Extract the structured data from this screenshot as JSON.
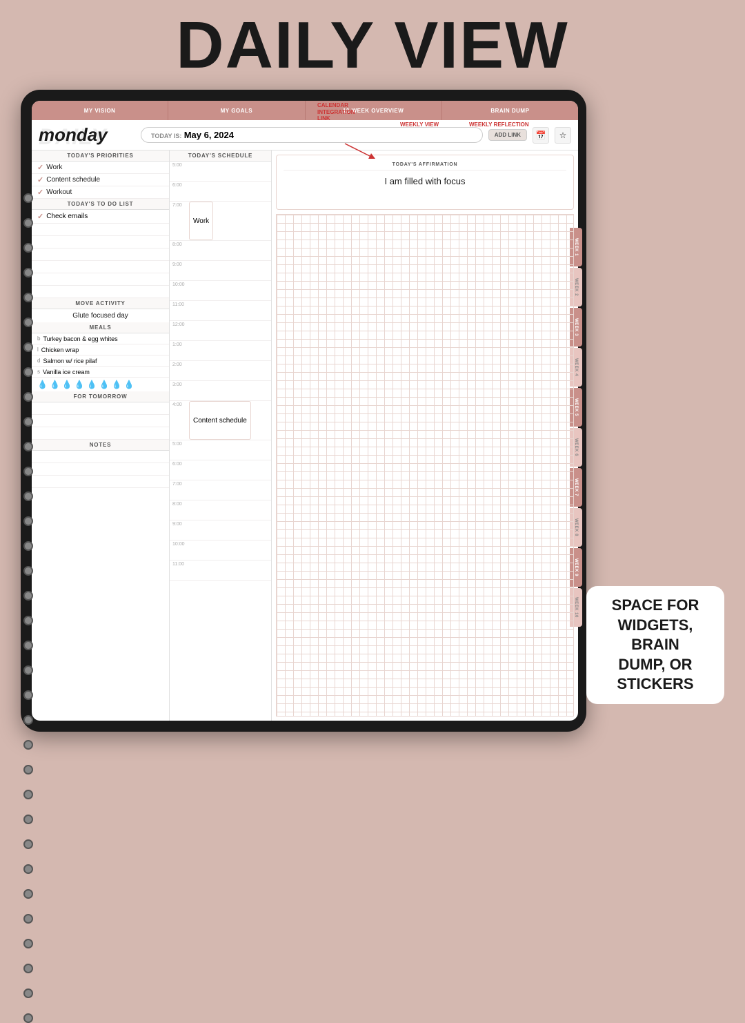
{
  "page": {
    "title": "DAILY VIEW",
    "background_color": "#d4b8b0"
  },
  "annotations": {
    "calendar_integration": "CALENDAR\nINTEGRATION\nLINK",
    "weekly_view": "WEEKLY VIEW",
    "weekly_reflection": "WEEKLY REFLECTION",
    "add_link": "ADD LINK",
    "widget_space": "SPACE FOR\nWIDGETS, BRAIN\nDUMP, OR STICKERS"
  },
  "nav_tabs": [
    {
      "label": "MY VISION"
    },
    {
      "label": "MY GOALS"
    },
    {
      "label": "12 WEEK OVERVIEW"
    },
    {
      "label": "BRAIN DUMP"
    }
  ],
  "side_tabs": [
    {
      "label": "WEEK 1"
    },
    {
      "label": "WEEK 2"
    },
    {
      "label": "WEEK 3"
    },
    {
      "label": "WEEK 4"
    },
    {
      "label": "WEEK 5"
    },
    {
      "label": "WEEK 6"
    },
    {
      "label": "WEEK 7"
    },
    {
      "label": "WEEK 8"
    },
    {
      "label": "WEEK 9"
    },
    {
      "label": "WEEK 10"
    }
  ],
  "header": {
    "day": "monday",
    "today_label": "TODAY IS:",
    "today_date": "May 6, 2024",
    "add_link_label": "ADD LINK"
  },
  "priorities": {
    "section_title": "TODAY'S PRIORITIES",
    "items": [
      {
        "checked": true,
        "text": "Work"
      },
      {
        "checked": true,
        "text": "Content schedule"
      },
      {
        "checked": true,
        "text": "Workout"
      }
    ]
  },
  "todo": {
    "section_title": "TODAY'S TO DO LIST",
    "items": [
      {
        "checked": true,
        "text": "Check emails"
      },
      {
        "checked": false,
        "text": ""
      },
      {
        "checked": false,
        "text": ""
      },
      {
        "checked": false,
        "text": ""
      },
      {
        "checked": false,
        "text": ""
      },
      {
        "checked": false,
        "text": ""
      },
      {
        "checked": false,
        "text": ""
      }
    ]
  },
  "move_activity": {
    "section_title": "MOVE ACTIVITY",
    "text": "Glute focused day"
  },
  "meals": {
    "section_title": "MEALS",
    "items": [
      {
        "type": "b",
        "text": "Turkey bacon & egg whites"
      },
      {
        "type": "l",
        "text": "Chicken wrap"
      },
      {
        "type": "d",
        "text": "Salmon w/ rice pilaf"
      },
      {
        "type": "s",
        "text": "Vanilla ice cream"
      }
    ],
    "water_drops": 8
  },
  "for_tomorrow": {
    "section_title": "FOR TOMORROW",
    "items": [
      "",
      "",
      ""
    ]
  },
  "notes": {
    "section_title": "NOTES",
    "items": [
      "",
      "",
      ""
    ]
  },
  "schedule": {
    "section_title": "TODAY'S SCHEDULE",
    "time_slots": [
      {
        "time": "5:00",
        "event": ""
      },
      {
        "time": "6:00",
        "event": ""
      },
      {
        "time": "7:00",
        "event": "Work",
        "duration": 2
      },
      {
        "time": "8:00",
        "event": ""
      },
      {
        "time": "9:00",
        "event": ""
      },
      {
        "time": "10:00",
        "event": ""
      },
      {
        "time": "11:00",
        "event": ""
      },
      {
        "time": "12:00",
        "event": ""
      },
      {
        "time": "1:00",
        "event": ""
      },
      {
        "time": "2:00",
        "event": ""
      },
      {
        "time": "3:00",
        "event": ""
      },
      {
        "time": "4:00",
        "event": "Content schedule",
        "duration": 2
      },
      {
        "time": "5:00",
        "event": ""
      },
      {
        "time": "6:00",
        "event": ""
      },
      {
        "time": "7:00",
        "event": ""
      },
      {
        "time": "8:00",
        "event": ""
      },
      {
        "time": "9:00",
        "event": ""
      },
      {
        "time": "10:00",
        "event": ""
      },
      {
        "time": "11:00",
        "event": ""
      }
    ]
  },
  "affirmation": {
    "section_title": "TODAY'S AFFIRMATION",
    "text": "I am filled with focus"
  }
}
